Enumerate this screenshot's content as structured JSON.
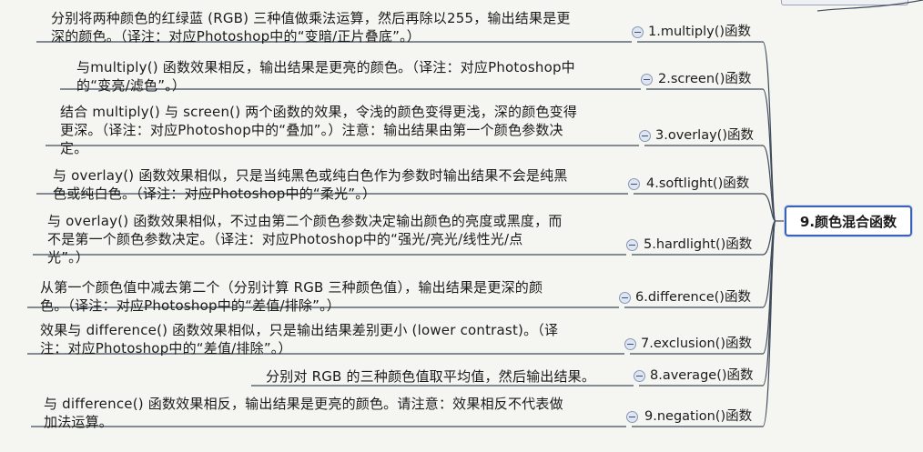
{
  "root": {
    "label": "9.颜色混合函数"
  },
  "nodes": [
    {
      "fn": "1.multiply()函数",
      "desc": [
        "分别将两种颜色的红绿蓝 (RGB) 三种值做乘法运算，然后再除以255，输出结果是更",
        "深的颜色。（译注：对应Photoshop中的“变暗/正片叠底”。）"
      ]
    },
    {
      "fn": "2.screen()函数",
      "desc": [
        "与multiply() 函数效果相反，输出结果是更亮的颜色。（译注：对应Photoshop中",
        "的“变亮/滤色”。）"
      ]
    },
    {
      "fn": "3.overlay()函数",
      "desc": [
        "结合 multiply() 与 screen() 两个函数的效果，令浅的颜色变得更浅，深的颜色变得",
        "更深。（译注：对应Photoshop中的“叠加”。）注意：输出结果由第一个颜色参数决",
        "定。"
      ]
    },
    {
      "fn": "4.softlight()函数",
      "desc": [
        "与 overlay() 函数效果相似，只是当纯黑色或纯白色作为参数时输出结果不会是纯黑",
        "色或纯白色。（译注：对应Photoshop中的“柔光”。）"
      ]
    },
    {
      "fn": "5.hardlight()函数",
      "desc": [
        "与 overlay() 函数效果相似，不过由第二个颜色参数决定输出颜色的亮度或黑度，而",
        "不是第一个颜色参数决定。（译注：对应Photoshop中的“强光/亮光/线性光/点",
        "光”。）"
      ]
    },
    {
      "fn": "6.difference()函数",
      "desc": [
        "从第一个颜色值中减去第二个（分别计算 RGB 三种颜色值），输出结果是更深的颜",
        "色。（译注：对应Photoshop中的“差值/排除”。）"
      ]
    },
    {
      "fn": "7.exclusion()函数",
      "desc": [
        "效果与 difference() 函数效果相似，只是输出结果差别更小 (lower contrast)。（译",
        "注：对应Photoshop中的“差值/排除”。）"
      ]
    },
    {
      "fn": "8.average()函数",
      "desc": [
        "分别对 RGB 的三种颜色值取平均值，然后输出结果。"
      ]
    },
    {
      "fn": "9.negation()函数",
      "desc": [
        "与 difference() 函数效果相反，输出结果是更亮的颜色。请注意：效果相反不代表做",
        "加法运算。"
      ]
    }
  ],
  "colors": {
    "link": "#3f4a5a",
    "root_border": "#3a63b8"
  }
}
